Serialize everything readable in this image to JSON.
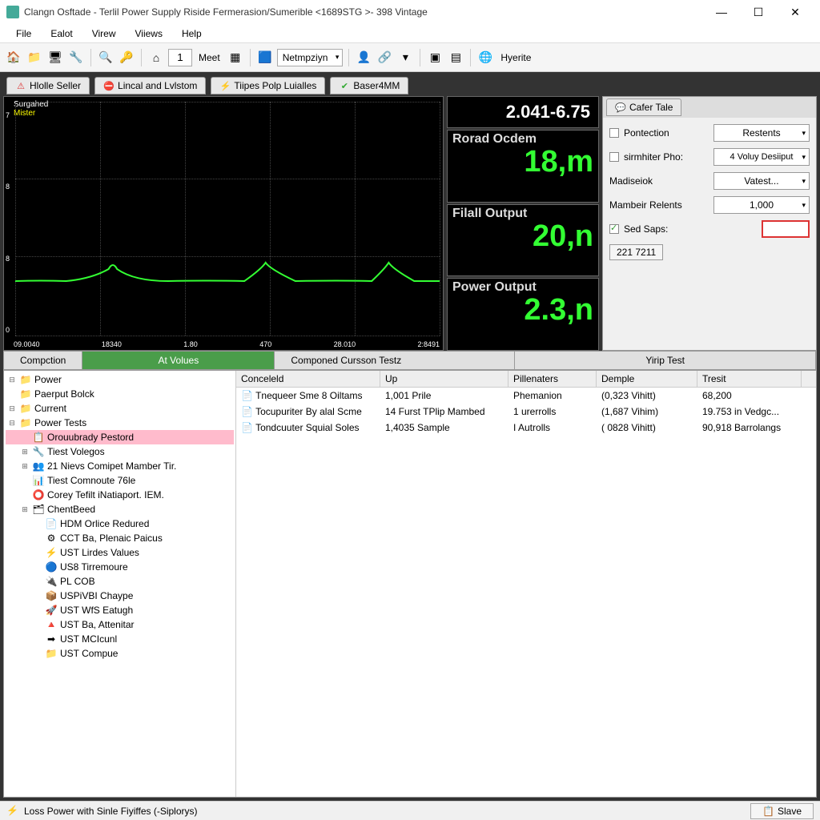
{
  "window": {
    "title": "Clangn Osftade - Terlil Power Supply Riside Fermerasion/Sumerible <1689STG >- 398 Vintage"
  },
  "menu": {
    "file": "File",
    "edit": "Ealot",
    "view": "Virew",
    "views": "Viiews",
    "help": "Help"
  },
  "toolbar": {
    "page_input": "1",
    "meet": "Meet",
    "netmpziyn": "Netmpziyn",
    "hyerite": "Hyerite"
  },
  "upper_tabs": {
    "hlolle": "Hlolle Seller",
    "lincal": "Lincal and Lvlstom",
    "tiipes": "Tiipes Polp Luialles",
    "baser": "Baser4MM"
  },
  "plot": {
    "legend1": "Surgahed",
    "legend2": "Mister",
    "y_ticks": [
      "7",
      "8",
      "8",
      "0"
    ],
    "x_ticks": [
      "09.0040",
      "18340",
      "1.80",
      "470",
      "28.010",
      "2:8491"
    ]
  },
  "readouts": {
    "top": "2.041-6.75",
    "r1_label": "Rorad Ocdem",
    "r1_val": "18,m",
    "r2_label": "Filall Output",
    "r2_val": "20,n",
    "r3_label": "Power Output",
    "r3_val": "2.3,n"
  },
  "props": {
    "tab": "Cafer Tale",
    "pontection": "Pontection",
    "restents": "Restents",
    "sirmhiter": "sirmhiter Pho:",
    "volux": "4 Voluy Desiiput",
    "madiseiok": "Madiseiok",
    "vatest": "Vatest...",
    "mambeir": "Mambeir Relents",
    "mambeir_val": "1,000",
    "sed_saps": "Sed Saps:",
    "small_val": "221 7211"
  },
  "mid_tabs": {
    "compction": "Compction",
    "at_volues": "At Volues",
    "componed": "Componed Cursson Testz",
    "yirip": "Yirip Test"
  },
  "tree": [
    {
      "l": 0,
      "exp": "⊟",
      "ico": "📁",
      "t": "Power"
    },
    {
      "l": 0,
      "exp": "",
      "ico": "📁",
      "t": "Paerput Bolck"
    },
    {
      "l": 0,
      "exp": "⊟",
      "ico": "📁",
      "t": "Current"
    },
    {
      "l": 0,
      "exp": "⊟",
      "ico": "📁",
      "t": "Power Tests"
    },
    {
      "l": 1,
      "exp": "",
      "ico": "📋",
      "t": "Orouubrady Pestord",
      "sel": true
    },
    {
      "l": 1,
      "exp": "⊞",
      "ico": "🔧",
      "t": "Tiest Volegos"
    },
    {
      "l": 1,
      "exp": "⊞",
      "ico": "👥",
      "t": "21 Nievs Comipet Mamber Tir."
    },
    {
      "l": 1,
      "exp": "",
      "ico": "📊",
      "t": "Tiest Comnoute 76le"
    },
    {
      "l": 1,
      "exp": "",
      "ico": "⭕",
      "t": "Corey Tefilt iNatiaport. IEM."
    },
    {
      "l": 1,
      "exp": "⊞",
      "ico": "🗂",
      "t": "ChentBeed"
    },
    {
      "l": 2,
      "exp": "",
      "ico": "📄",
      "t": "HDM Orlice Redured"
    },
    {
      "l": 2,
      "exp": "",
      "ico": "⚙",
      "t": "CCT Ba, Plenaic Paicus"
    },
    {
      "l": 2,
      "exp": "",
      "ico": "⚡",
      "t": "UST Lirdes Values"
    },
    {
      "l": 2,
      "exp": "",
      "ico": "🔵",
      "t": "US8 Tirremoure"
    },
    {
      "l": 2,
      "exp": "",
      "ico": "🔌",
      "t": "PL COB"
    },
    {
      "l": 2,
      "exp": "",
      "ico": "📦",
      "t": "USPiVBI Chaype"
    },
    {
      "l": 2,
      "exp": "",
      "ico": "🚀",
      "t": "UST WfS Eatugh"
    },
    {
      "l": 2,
      "exp": "",
      "ico": "🔺",
      "t": "UST Ba, Attenitar"
    },
    {
      "l": 2,
      "exp": "",
      "ico": "➡",
      "t": "UST MCIcunl"
    },
    {
      "l": 2,
      "exp": "",
      "ico": "📁",
      "t": "UST Compue"
    }
  ],
  "table": {
    "headers": [
      "Conceleld",
      "Up",
      "Pillenaters",
      "Demple",
      "Tresit"
    ],
    "rows": [
      [
        "Tnequeer Sme 8 Oiltams",
        "1,001 Prile",
        "Phemanion",
        "(0,323 Vihitt)",
        "68,200"
      ],
      [
        "Tocupuriter By alal Scme",
        "14 Furst TPlip Mambed",
        "1 urerrolls",
        "(1,687 Vihim)",
        "19.753 in Vedgc..."
      ],
      [
        "Tondcuuter Squial Soles",
        "1,4035 Sample",
        "I Autrolls",
        "( 0828 Vihitt)",
        "90,918 Barrolangs"
      ]
    ]
  },
  "status": {
    "text": "Loss Power with Sinle Fiyiffes (-Siplorys)",
    "slave": "Slave"
  }
}
